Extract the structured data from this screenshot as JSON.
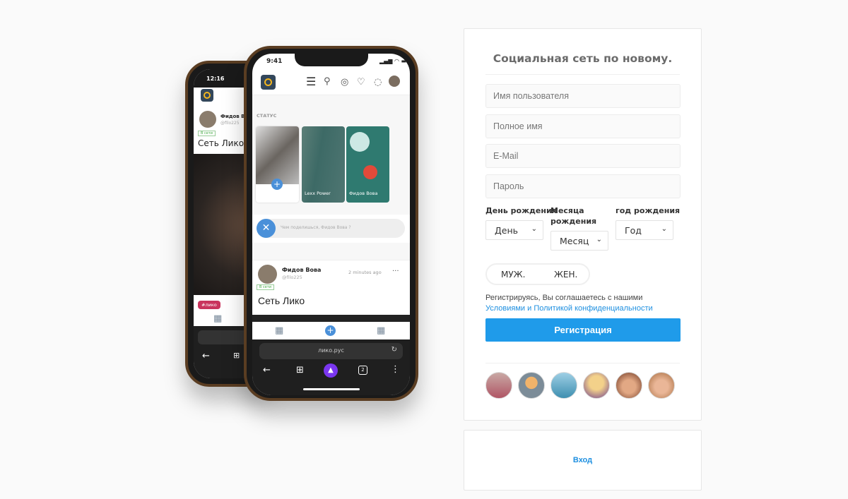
{
  "phone_front": {
    "time": "9:41",
    "status_label": "СТАТУС",
    "stories": [
      {
        "name": ""
      },
      {
        "name": "Lexx Power"
      },
      {
        "name": "Фидов Вова"
      }
    ],
    "composer_placeholder": "Чем поделишься, Фидов Вова ?",
    "post": {
      "author": "Фидов Вова",
      "handle": "@filo225",
      "time": "2 minutes ago",
      "online_badge": "В сети",
      "text": "Сеть Лико"
    },
    "url": "лико.рус",
    "tabs_count": "2"
  },
  "phone_back": {
    "time": "12:16",
    "post": {
      "author": "Фидов В",
      "handle": "@filo225",
      "online_badge": "В сети",
      "text": "Сеть Лико"
    },
    "tag": "#лико"
  },
  "signup": {
    "title": "Социальная сеть по новому.",
    "username_placeholder": "Имя пользователя",
    "fullname_placeholder": "Полное имя",
    "email_placeholder": "E-Mail",
    "password_placeholder": "Пароль",
    "day_label": "День рождения",
    "month_label": "Месяца рождения",
    "year_label": "год рождения",
    "day_value": "День",
    "month_value": "Месяц",
    "year_value": "Год",
    "male": "МУЖ.",
    "female": "ЖЕН.",
    "terms_text": "Регистрируясь, Вы соглашаетесь с нашими",
    "terms_link": "Условиями и Политикой конфиденциальности",
    "register_button": "Регистрация",
    "accent": "#1f9bea"
  },
  "login": {
    "link": "Вход"
  }
}
